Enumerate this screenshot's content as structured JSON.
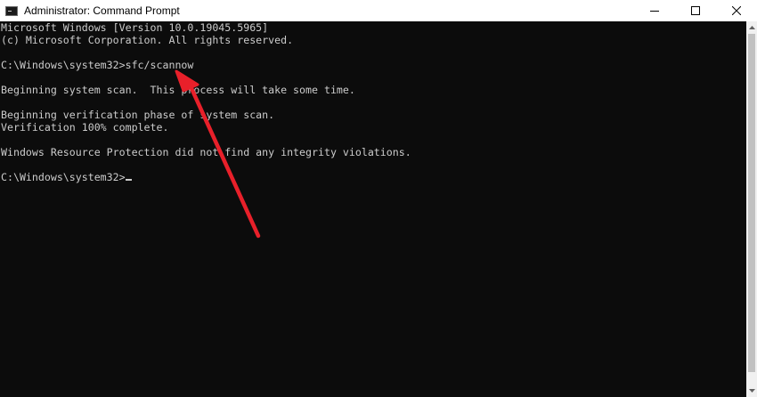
{
  "window": {
    "title": "Administrator: Command Prompt"
  },
  "title_controls": {
    "minimize_icon": "minimize-icon",
    "maximize_icon": "maximize-icon",
    "close_icon": "close-icon"
  },
  "console": {
    "lines": [
      "Microsoft Windows [Version 10.0.19045.5965]",
      "(c) Microsoft Corporation. All rights reserved.",
      "",
      "C:\\Windows\\system32>sfc/scannow",
      "",
      "Beginning system scan.  This process will take some time.",
      "",
      "Beginning verification phase of system scan.",
      "Verification 100% complete.",
      "",
      "Windows Resource Protection did not find any integrity violations.",
      ""
    ],
    "current_prompt": "C:\\Windows\\system32>"
  },
  "colors": {
    "background": "#0c0c0c",
    "text": "#cccccc",
    "annotation_arrow": "#e8202a"
  }
}
